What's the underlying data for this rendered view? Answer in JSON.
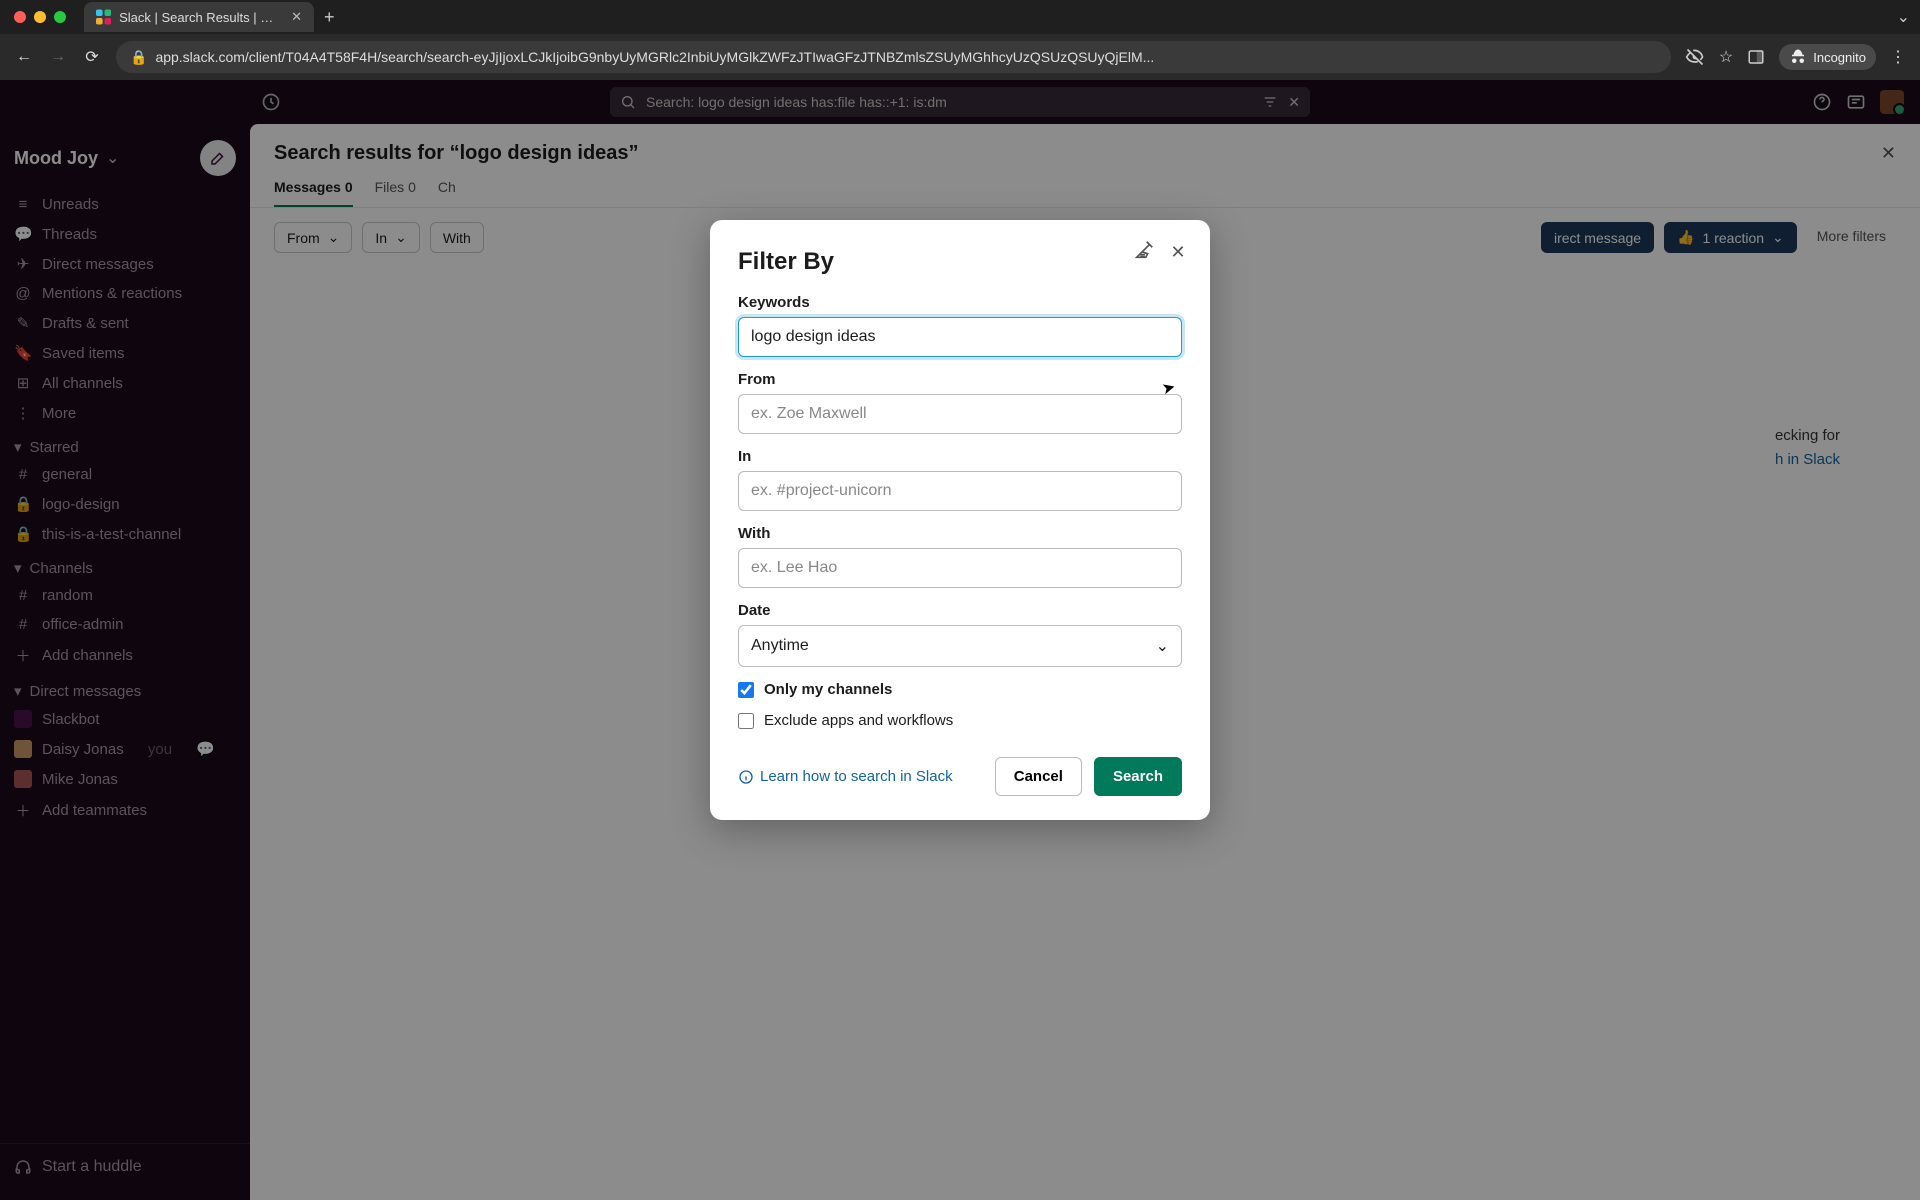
{
  "browser": {
    "tab_title": "Slack | Search Results | Mood",
    "url": "app.slack.com/client/T04A4T58F4H/search/search-eyJjIjoxLCJkIjoibG9nbyUyMGRlc2InbiUyMGlkZWFzJTIwaGFzJTNBZmlsZSUyMGhhcyUzQSUzQSUyQjElM..."
  },
  "incognito_label": "Incognito",
  "slack": {
    "search_bar": "Search: logo design ideas has:file has::+1: is:dm",
    "workspace": "Mood Joy",
    "nav": {
      "unreads": "Unreads",
      "threads": "Threads",
      "dms": "Direct messages",
      "mentions": "Mentions & reactions",
      "drafts": "Drafts & sent",
      "saved": "Saved items",
      "all_channels": "All channels",
      "more": "More"
    },
    "sections": {
      "starred": "Starred",
      "channels": "Channels",
      "dms": "Direct messages"
    },
    "starred": [
      "general",
      "logo-design",
      "this-is-a-test-channel"
    ],
    "channels": [
      "random",
      "office-admin"
    ],
    "add_channels": "Add channels",
    "dms": [
      {
        "name": "Slackbot"
      },
      {
        "name": "Daisy Jonas",
        "you": "you"
      },
      {
        "name": "Mike Jonas"
      }
    ],
    "add_teammates": "Add teammates",
    "huddle": "Start a huddle",
    "results_title_prefix": "Search results for “",
    "results_title_query": "logo design ideas",
    "results_title_suffix": "”",
    "tabs": {
      "messages": "Messages",
      "messages_count": "0",
      "files": "Files",
      "files_count": "0",
      "channels": "Ch"
    },
    "filters": {
      "from": "From",
      "in": "In",
      "with": "With",
      "dm": "irect message",
      "reaction_emoji": "👍",
      "reaction": "1 reaction",
      "more": "More filters"
    },
    "hint_line1": "ecking for",
    "hint_link": "h in Slack"
  },
  "modal": {
    "title": "Filter By",
    "keywords_label": "Keywords",
    "keywords_value": "logo design ideas",
    "from_label": "From",
    "from_placeholder": "ex. Zoe Maxwell",
    "in_label": "In",
    "in_placeholder": "ex. #project-unicorn",
    "with_label": "With",
    "with_placeholder": "ex. Lee Hao",
    "date_label": "Date",
    "date_value": "Anytime",
    "only_my_channels": "Only my channels",
    "exclude_apps": "Exclude apps and workflows",
    "learn": "Learn how to search in Slack",
    "cancel": "Cancel",
    "search": "Search"
  }
}
